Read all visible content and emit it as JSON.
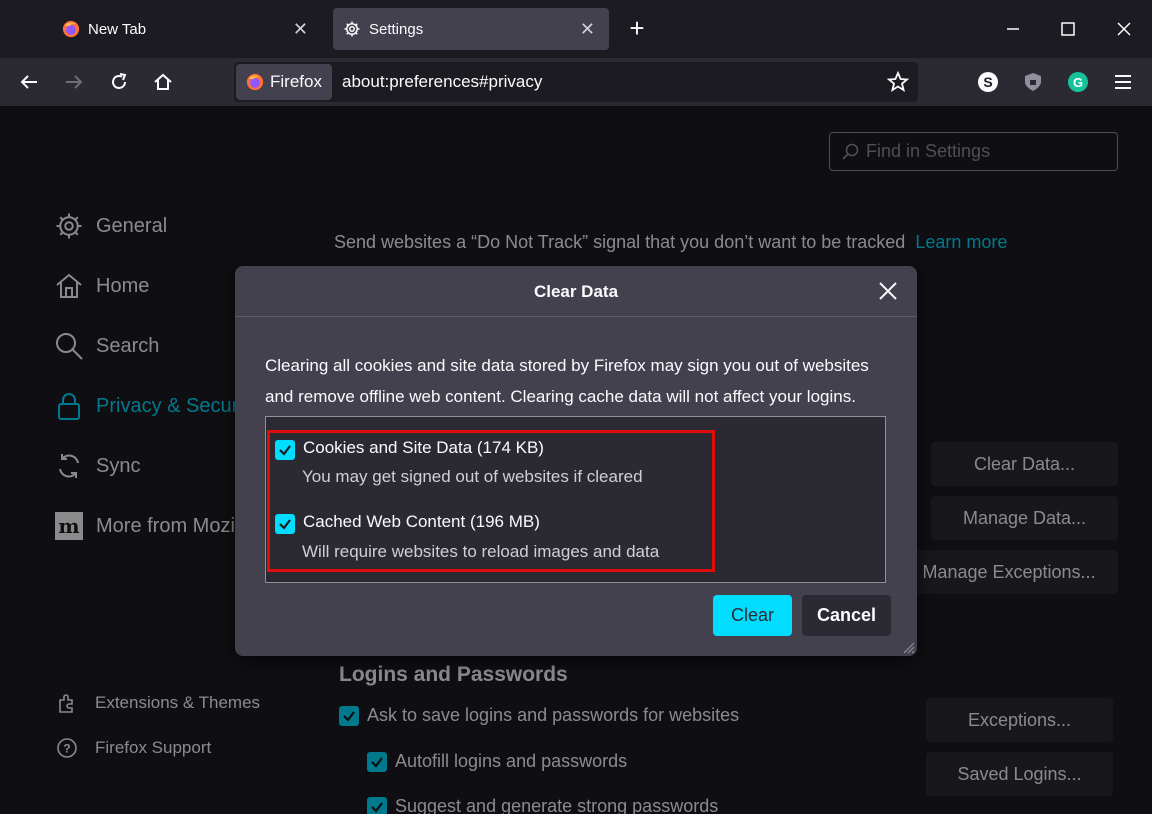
{
  "tabs": [
    {
      "title": "New Tab",
      "icon": "firefox-icon"
    },
    {
      "title": "Settings",
      "icon": "gear-icon"
    }
  ],
  "urlbar": {
    "identity_label": "Firefox",
    "url": "about:preferences#privacy"
  },
  "find": {
    "placeholder": "Find in Settings"
  },
  "sidebar": {
    "items": [
      {
        "label": "General",
        "icon": "gear-icon"
      },
      {
        "label": "Home",
        "icon": "home-icon"
      },
      {
        "label": "Search",
        "icon": "search-icon"
      },
      {
        "label": "Privacy & Security",
        "icon": "lock-icon"
      },
      {
        "label": "Sync",
        "icon": "sync-icon"
      },
      {
        "label": "More from Mozilla",
        "icon": "mozilla-icon"
      }
    ],
    "footer": [
      {
        "label": "Extensions & Themes",
        "icon": "puzzle-icon"
      },
      {
        "label": "Firefox Support",
        "icon": "help-icon"
      }
    ]
  },
  "privacy": {
    "dnt_text": "Send websites a “Do Not Track” signal that you don’t want to be tracked",
    "learn_more": "Learn more",
    "clear_data_btn": "Clear Data...",
    "manage_data_btn": "Manage Data...",
    "manage_exceptions_btn": "Manage Exceptions..."
  },
  "logins": {
    "title": "Logins and Passwords",
    "ask_save": "Ask to save logins and passwords for websites",
    "autofill": "Autofill logins and passwords",
    "suggest": "Suggest and generate strong passwords",
    "exceptions_btn": "Exceptions...",
    "saved_logins_btn": "Saved Logins..."
  },
  "dialog": {
    "title": "Clear Data",
    "description": "Clearing all cookies and site data stored by Firefox may sign you out of websites and remove offline web content. Clearing cache data will not affect your logins.",
    "options": [
      {
        "label": "Cookies and Site Data (174 KB)",
        "sub": "You may get signed out of websites if cleared",
        "checked": true
      },
      {
        "label": "Cached Web Content (196 MB)",
        "sub": "Will require websites to reload images and data",
        "checked": true
      }
    ],
    "clear_btn": "Clear",
    "cancel_btn": "Cancel"
  },
  "colors": {
    "accent": "#00ddff",
    "highlight_border": "#e00d0d",
    "background": "#1c1b22",
    "dialog": "#42414d"
  }
}
